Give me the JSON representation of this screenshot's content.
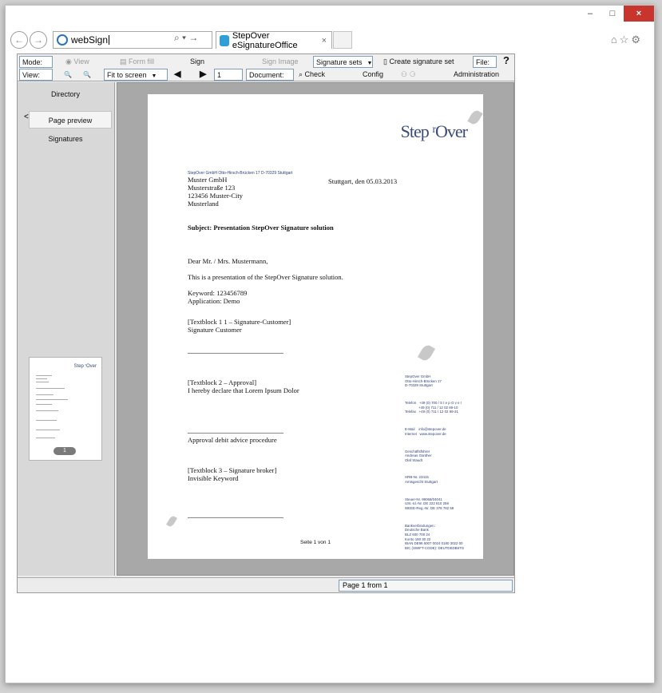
{
  "browser": {
    "address": "webSign",
    "address_tools": "⌕ ▾ →",
    "tab_title": "StepOver eSignatureOffice",
    "tab_close": "×",
    "right_icons": "⌂☆⚙",
    "win_min": "‒",
    "win_max": "□",
    "win_close": "×",
    "back_icon": "←",
    "forward_icon": "→"
  },
  "toolbar": {
    "mode_label": "Mode:",
    "view_mode_label": "View",
    "formfill_label": "Form fill",
    "sign_label": "Sign",
    "signimage_label": "Sign Image",
    "signature_sets": "Signature sets",
    "create_signature_set": "Create signature set",
    "file_label": "File:",
    "help": "?",
    "view_label": "View:",
    "zoom_in": "🔍",
    "zoom_out": "🔍",
    "fit": "Fit to screen",
    "page_input": "1",
    "document_label": "Document:",
    "check_label": "Check",
    "config_label": "Config",
    "admin_label": "Administration"
  },
  "sidebar": {
    "items": [
      {
        "label": "Directory"
      },
      {
        "label": "Page preview"
      },
      {
        "label": "Signatures"
      }
    ],
    "back": "<",
    "thumb_page": "1"
  },
  "document": {
    "brand": "Step ʳOver",
    "sender_line": "StepOver GmbH   Otto-Hirsch-Brücken 17   D-70329 Stuttgart",
    "address": [
      "Muster GmbH",
      "Musterstraße 123",
      "123456 Muster-City",
      "Musterland"
    ],
    "date": "Stuttgart, den 05.03.2013",
    "subject": "Subject: Presentation StepOver Signature solution",
    "salutation": "Dear Mr. / Mrs. Mustermann,",
    "intro": "This is a presentation of the StepOver Signature solution.",
    "keyword": "Keyword: 123456789",
    "application": "Application: Demo",
    "tb1": "[Textblock 1 1 – Signature-Customer]",
    "tb1b": "Signature Customer",
    "tb2": "[Textblock 2 – Approval]",
    "tb2b": "I hereby declare that Lorem Ipsum Dolor",
    "approval": "Approval debit advice procedure",
    "tb3": "[Textblock 3 – Signature broker]",
    "tb3b": "Invisible Keyword",
    "page_footer": "Seite 1 von 1",
    "footer_blocks": [
      "StepOver GmbH\nOtto-Hirsch-Brücken 17\nD-70329 Stuttgart",
      "Telefon   +49 (0) 700 / S t e p O v e r\n              +49 (0) 711 / 12 02 69-10\nTelefax   +49 (0) 711 / 12 02 69-31",
      "E-Mail    info@stepover.de\nInternet   www.stepover.de",
      "Geschäftsführer\nAndreas Günther\nOlaf Staudt",
      "HRB-Nr. 23415\nAmtsgericht Stuttgart",
      "Steuer-Nr. 99068/04041\nUSt.-Id.-Nr. DE 222 810 259\nWEEE-Reg.-Nr. DE 378 782 59",
      "Bankverbindungen:\nDeutsche Bank\nBLZ 600 700 24\nKonto 180 30 22\nIBAN DE96 6007 0024 0180 3022 00\nBIC (SWIFT-CODE): DEUTDEDB6TG"
    ]
  },
  "status": {
    "page_info": "Page 1 from 1"
  }
}
